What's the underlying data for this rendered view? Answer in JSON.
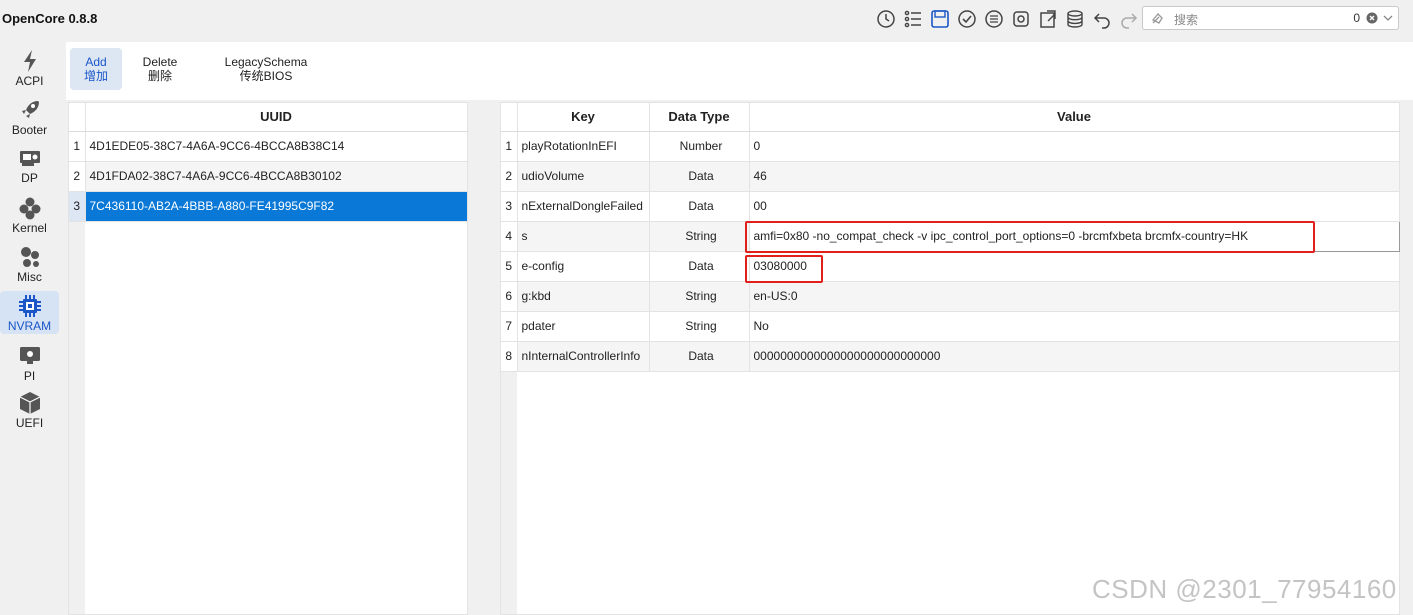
{
  "app": {
    "title": "OpenCore 0.8.8"
  },
  "toolbar_icons": [
    "clock-icon",
    "list-icon",
    "save-icon",
    "check-circle-icon",
    "refresh-list-icon",
    "gear-refresh-icon",
    "import-icon",
    "database-icon",
    "undo-icon",
    "redo-icon"
  ],
  "search": {
    "placeholder": "搜索",
    "count": "0"
  },
  "sidebar": {
    "items": [
      {
        "label": "ACPI",
        "icon": "bolt-icon"
      },
      {
        "label": "Booter",
        "icon": "rocket-icon"
      },
      {
        "label": "DP",
        "icon": "gpu-card-icon"
      },
      {
        "label": "Kernel",
        "icon": "kernel-icon"
      },
      {
        "label": "Misc",
        "icon": "misc-icon"
      },
      {
        "label": "NVRAM",
        "icon": "chip-icon",
        "active": true
      },
      {
        "label": "PI",
        "icon": "apple-monitor-icon"
      },
      {
        "label": "UEFI",
        "icon": "cube-icon"
      }
    ]
  },
  "subtoolbar": {
    "add": {
      "en": "Add",
      "zh": "增加"
    },
    "delete": {
      "en": "Delete",
      "zh": "删除"
    },
    "legacy": {
      "en": "LegacySchema",
      "zh": "传统BIOS"
    }
  },
  "uuid_table": {
    "header": "UUID",
    "rows": [
      {
        "num": "1",
        "uuid": "4D1EDE05-38C7-4A6A-9CC6-4BCCA8B38C14"
      },
      {
        "num": "2",
        "uuid": "4D1FDA02-38C7-4A6A-9CC6-4BCCA8B30102"
      },
      {
        "num": "3",
        "uuid": "7C436110-AB2A-4BBB-A880-FE41995C9F82",
        "selected": true
      }
    ]
  },
  "kv_table": {
    "headers": {
      "key": "Key",
      "type": "Data Type",
      "value": "Value"
    },
    "rows": [
      {
        "num": "1",
        "key": "playRotationInEFI",
        "type": "Number",
        "value": "0"
      },
      {
        "num": "2",
        "key": "udioVolume",
        "type": "Data",
        "value": "46"
      },
      {
        "num": "3",
        "key": "nExternalDongleFailed",
        "type": "Data",
        "value": "00"
      },
      {
        "num": "4",
        "key": "s",
        "type": "String",
        "value": "amfi=0x80 -no_compat_check -v ipc_control_port_options=0 -brcmfxbeta brcmfx-country=HK"
      },
      {
        "num": "5",
        "key": "e-config",
        "type": "Data",
        "value": "03080000"
      },
      {
        "num": "6",
        "key": "g:kbd",
        "type": "String",
        "value": "en-US:0"
      },
      {
        "num": "7",
        "key": "pdater",
        "type": "String",
        "value": "No"
      },
      {
        "num": "8",
        "key": "nInternalControllerInfo",
        "type": "Data",
        "value": "0000000000000000000000000000"
      }
    ]
  },
  "watermark": "CSDN @2301_77954160"
}
